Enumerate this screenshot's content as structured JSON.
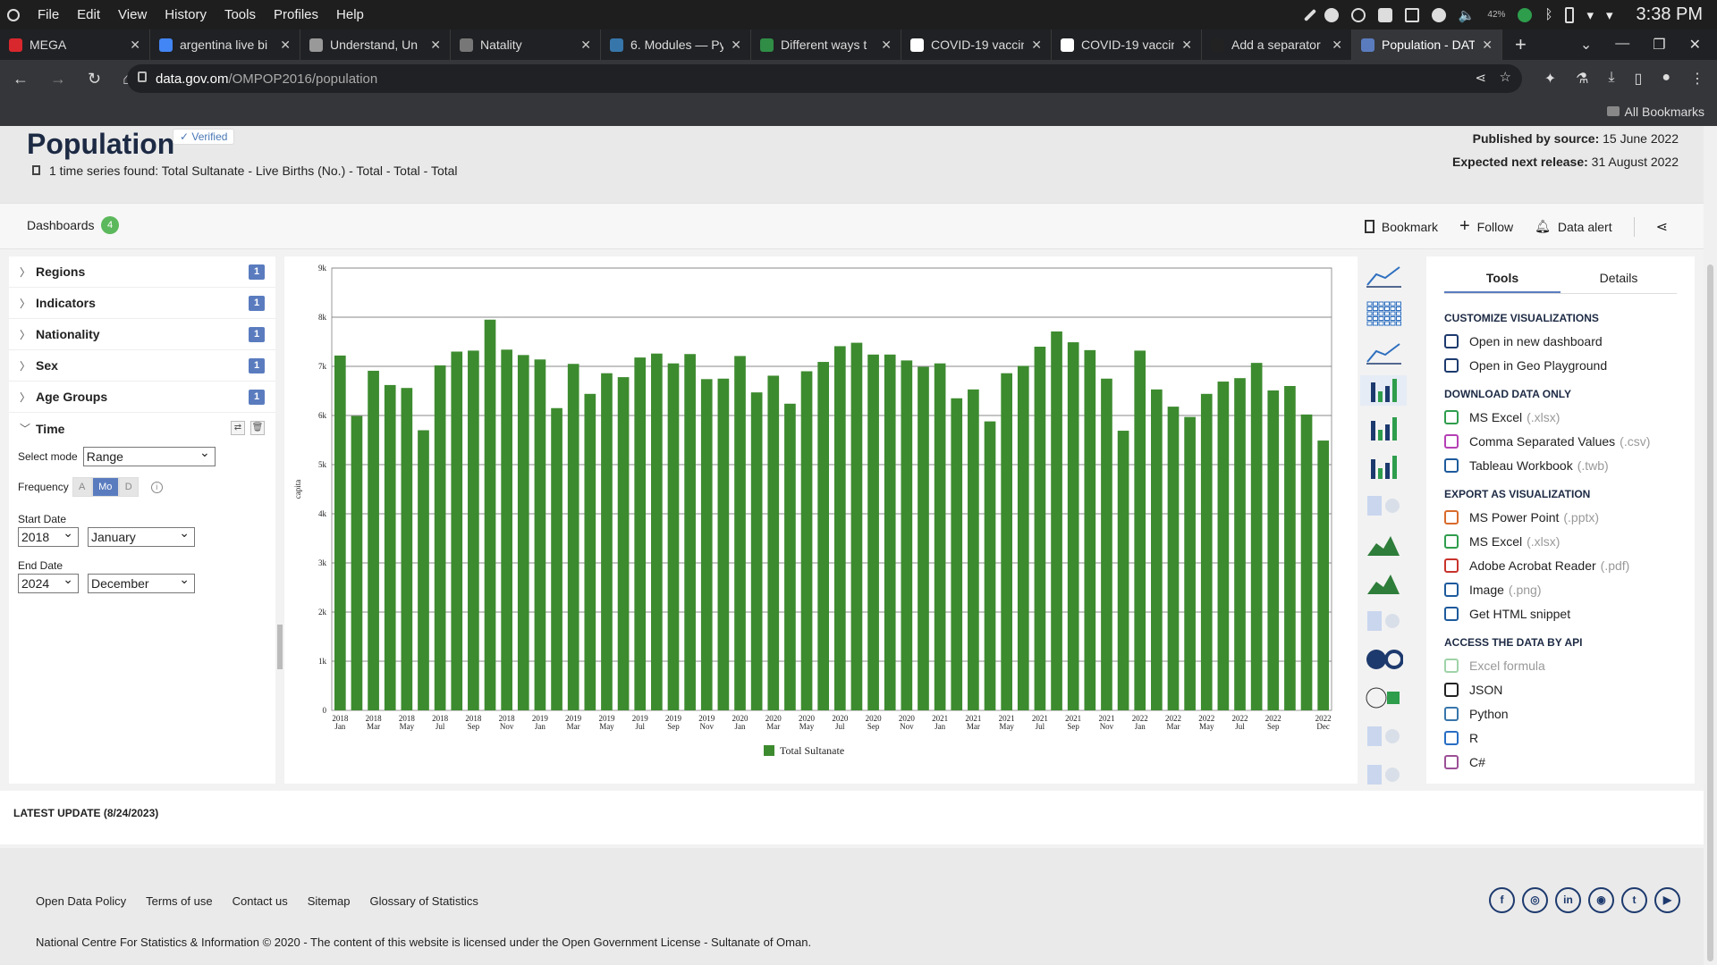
{
  "os": {
    "menu": [
      "File",
      "Edit",
      "View",
      "History",
      "Tools",
      "Profiles",
      "Help"
    ],
    "battery": "42%",
    "clock": "3:38 PM"
  },
  "tabs": [
    {
      "title": "MEGA",
      "icon": "mega-icon",
      "color": "#d9272e"
    },
    {
      "title": "argentina live bi",
      "icon": "google-icon",
      "color": "#4285f4"
    },
    {
      "title": "Understand, Un",
      "icon": "globe-icon",
      "color": "#999"
    },
    {
      "title": "Natality",
      "icon": "natality-icon",
      "color": "#777"
    },
    {
      "title": "6. Modules — Py",
      "icon": "python-icon",
      "color": "#3776ab"
    },
    {
      "title": "Different ways t",
      "icon": "geeks-icon",
      "color": "#2f8d46"
    },
    {
      "title": "COVID-19 vaccin",
      "icon": "wikipedia-icon",
      "color": "#fff"
    },
    {
      "title": "COVID-19 vaccin",
      "icon": "wikipedia-icon",
      "color": "#fff"
    },
    {
      "title": "Add a separator",
      "icon": "add-separator-icon",
      "color": "#222"
    },
    {
      "title": "Population - DAT",
      "icon": "data-gov-icon",
      "color": "#5a7cbf"
    }
  ],
  "address": {
    "host": "data.gov.om",
    "path": "/OMPOP2016/population"
  },
  "bookmarks": {
    "all": "All Bookmarks"
  },
  "header": {
    "title": "Population",
    "verified": "✓ Verified",
    "series": "1 time series found: Total Sultanate - Live Births (No.) - Total - Total - Total",
    "published_label": "Published by source:",
    "published_value": " 15 June 2022",
    "next_label": "Expected next release:",
    "next_value": " 31 August 2022"
  },
  "toolbar": {
    "dashboards": "Dashboards",
    "dash_count": "4",
    "bookmark": "Bookmark",
    "follow": "Follow",
    "alert": "Data alert"
  },
  "facets": [
    {
      "label": "Regions",
      "count": "1"
    },
    {
      "label": "Indicators",
      "count": "1"
    },
    {
      "label": "Nationality",
      "count": "1"
    },
    {
      "label": "Sex",
      "count": "1"
    },
    {
      "label": "Age Groups",
      "count": "1"
    }
  ],
  "time": {
    "label": "Time",
    "mode_label": "Select mode",
    "mode": "Range",
    "freq_label": "Frequency",
    "freq": [
      "A",
      "Mo",
      "D"
    ],
    "start_label": "Start Date",
    "start_year": "2018",
    "start_month": "January",
    "end_label": "End Date",
    "end_year": "2024",
    "end_month": "December"
  },
  "chart_data": {
    "type": "bar",
    "ylabel": "capita",
    "ylim": [
      0,
      9000
    ],
    "yticks": [
      "0",
      "1k",
      "2k",
      "3k",
      "4k",
      "5k",
      "6k",
      "7k",
      "8k",
      "9k"
    ],
    "series": [
      {
        "name": "Total Sultanate",
        "color": "#3d8b2f",
        "values": [
          7220,
          5990,
          6910,
          6620,
          6560,
          5700,
          7020,
          7300,
          7320,
          7950,
          7340,
          7230,
          7140,
          6150,
          7050,
          6440,
          6860,
          6780,
          7180,
          7260,
          7060,
          7250,
          6740,
          6750,
          7210,
          6470,
          6810,
          6240,
          6900,
          7090,
          7410,
          7480,
          7240,
          7240,
          7120,
          6990,
          7060,
          6350,
          6530,
          5880,
          6860,
          7010,
          7400,
          7710,
          7490,
          7330,
          6750,
          5690,
          7320,
          6530,
          6180,
          5970,
          6440,
          6690,
          6760,
          7070,
          6510,
          6600,
          6020,
          5490
        ]
      }
    ],
    "xlabels": [
      [
        "2018",
        "Jan"
      ],
      [
        "2018",
        "Mar"
      ],
      [
        "2018",
        "May"
      ],
      [
        "2018",
        "Jul"
      ],
      [
        "2018",
        "Sep"
      ],
      [
        "2018",
        "Nov"
      ],
      [
        "2019",
        "Jan"
      ],
      [
        "2019",
        "Mar"
      ],
      [
        "2019",
        "May"
      ],
      [
        "2019",
        "Jul"
      ],
      [
        "2019",
        "Sep"
      ],
      [
        "2019",
        "Nov"
      ],
      [
        "2020",
        "Jan"
      ],
      [
        "2020",
        "Mar"
      ],
      [
        "2020",
        "May"
      ],
      [
        "2020",
        "Jul"
      ],
      [
        "2020",
        "Sep"
      ],
      [
        "2020",
        "Nov"
      ],
      [
        "2021",
        "Jan"
      ],
      [
        "2021",
        "Mar"
      ],
      [
        "2021",
        "May"
      ],
      [
        "2021",
        "Jul"
      ],
      [
        "2021",
        "Sep"
      ],
      [
        "2021",
        "Nov"
      ],
      [
        "2022",
        "Jan"
      ],
      [
        "2022",
        "Mar"
      ],
      [
        "2022",
        "May"
      ],
      [
        "2022",
        "Jul"
      ],
      [
        "2022",
        "Sep"
      ],
      [
        "2022",
        "Dec"
      ]
    ],
    "legend": "bottom-center",
    "grid": true
  },
  "tools": {
    "tab_tools": "Tools",
    "tab_details": "Details",
    "sections": [
      {
        "title": "CUSTOMIZE VISUALIZATIONS",
        "items": [
          {
            "label": "Open in new dashboard",
            "ext": "",
            "icon": "dashboard-icon",
            "color": "#1d3a6e"
          },
          {
            "label": "Open in Geo Playground",
            "ext": "",
            "icon": "geo-pin-icon",
            "color": "#1d3a6e"
          }
        ]
      },
      {
        "title": "DOWNLOAD DATA ONLY",
        "items": [
          {
            "label": "MS Excel",
            "ext": "(.xlsx)",
            "icon": "excel-icon",
            "color": "#2e9d4c"
          },
          {
            "label": "Comma Separated Values",
            "ext": "(.csv)",
            "icon": "csv-icon",
            "color": "#b43fb4"
          },
          {
            "label": "Tableau Workbook",
            "ext": "(.twb)",
            "icon": "tableau-icon",
            "color": "#1d5a9c"
          }
        ]
      },
      {
        "title": "EXPORT AS VISUALIZATION",
        "items": [
          {
            "label": "MS Power Point",
            "ext": "(.pptx)",
            "icon": "powerpoint-icon",
            "color": "#d86b2c"
          },
          {
            "label": "MS Excel",
            "ext": "(.xlsx)",
            "icon": "excel-icon",
            "color": "#2e9d4c"
          },
          {
            "label": "Adobe Acrobat Reader",
            "ext": "(.pdf)",
            "icon": "pdf-icon",
            "color": "#c8332b"
          },
          {
            "label": "Image",
            "ext": "(.png)",
            "icon": "image-icon",
            "color": "#1d5a9c"
          },
          {
            "label": "Get HTML snippet",
            "ext": "",
            "icon": "code-icon",
            "color": "#1d5a9c"
          }
        ]
      },
      {
        "title": "ACCESS THE DATA BY API",
        "items": [
          {
            "label": "Excel formula",
            "ext": "",
            "icon": "excel-formula-icon",
            "color": "#9fd3a8",
            "dim": true
          },
          {
            "label": "JSON",
            "ext": "",
            "icon": "json-icon",
            "color": "#222"
          },
          {
            "label": "Python",
            "ext": "",
            "icon": "python-icon",
            "color": "#3776ab"
          },
          {
            "label": "R",
            "ext": "",
            "icon": "r-icon",
            "color": "#276dc3"
          },
          {
            "label": "C#",
            "ext": "",
            "icon": "csharp-icon",
            "color": "#9b4f96"
          }
        ]
      }
    ]
  },
  "latest_update": "LATEST UPDATE (8/24/2023)",
  "footer": {
    "links": [
      "Open Data Policy",
      "Terms of use",
      "Contact us",
      "Sitemap",
      "Glossary of Statistics"
    ],
    "copyright": "National Centre For Statistics & Information © 2020 - The content of this website is licensed under the Open Government License - Sultanate of Oman.",
    "social": [
      {
        "name": "facebook-icon",
        "glyph": "f"
      },
      {
        "name": "instagram-icon",
        "glyph": "◎"
      },
      {
        "name": "linkedin-icon",
        "glyph": "in"
      },
      {
        "name": "rss-icon",
        "glyph": "◉"
      },
      {
        "name": "twitter-icon",
        "glyph": "t"
      },
      {
        "name": "youtube-icon",
        "glyph": "▶"
      }
    ]
  }
}
